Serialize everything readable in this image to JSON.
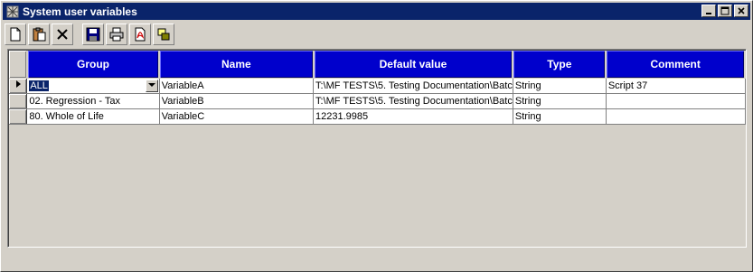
{
  "window": {
    "title": "System user variables",
    "controls": {
      "minimize": "minimize",
      "maximize": "maximize",
      "close": "close"
    }
  },
  "toolbar": {
    "items": [
      {
        "name": "new",
        "icon": "new-document-icon"
      },
      {
        "name": "paste",
        "icon": "paste-icon"
      },
      {
        "name": "delete",
        "icon": "delete-icon"
      },
      {
        "name": "save",
        "icon": "save-icon"
      },
      {
        "name": "print",
        "icon": "print-icon"
      },
      {
        "name": "export-pdf",
        "icon": "pdf-icon"
      },
      {
        "name": "copy-to",
        "icon": "copy-windows-icon"
      }
    ]
  },
  "grid": {
    "columns": [
      "Group",
      "Name",
      "Default value",
      "Type",
      "Comment"
    ],
    "rows": [
      {
        "group": "ALL",
        "name": "VariableA",
        "default_value": "T:\\MF TESTS\\5. Testing Documentation\\Batc",
        "type": "String",
        "comment": "Script 37"
      },
      {
        "group": "02. Regression - Tax",
        "name": "VariableB",
        "default_value": "T:\\MF TESTS\\5. Testing Documentation\\Batc",
        "type": "String",
        "comment": ""
      },
      {
        "group": "80. Whole of Life",
        "name": "VariableC",
        "default_value": "12231.9985",
        "type": "String",
        "comment": ""
      }
    ]
  },
  "colors": {
    "titlebar": "#0a246a",
    "header": "#0000cc",
    "face": "#d4d0c8"
  }
}
